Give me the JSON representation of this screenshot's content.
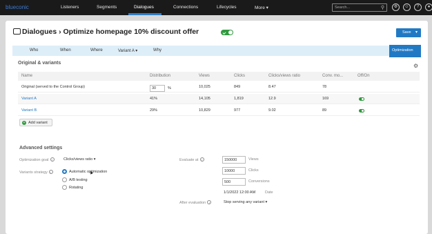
{
  "nav": {
    "logo": "blueconic",
    "items": [
      "Listeners",
      "Segments",
      "Dialogues",
      "Connections",
      "Lifecycles",
      "More ▾"
    ],
    "search_placeholder": "Search...",
    "icons": [
      "settings-icon",
      "user-icon",
      "help-icon",
      "account-icon"
    ]
  },
  "page": {
    "title": "Dialogues  ›  Optimize homepage 10% discount offer",
    "save_label": "Save",
    "tabs": [
      "Who",
      "When",
      "Where",
      "Variant A ▾",
      "Why"
    ],
    "active_tab": "Optimization"
  },
  "variants": {
    "heading": "Original & variants",
    "columns": [
      "Name",
      "Distribution",
      "Views",
      "Clicks",
      "Clicks/views ratio",
      "Conv. mo...",
      "Off/On"
    ],
    "rows": [
      {
        "name": "Original (served to the Control Group)",
        "distribution": "30",
        "pct": "%",
        "views": "10,025",
        "clicks": "849",
        "ratio": "8.47",
        "conv": "78",
        "toggle": false
      },
      {
        "name": "Variant A",
        "distribution": "41%",
        "views": "14,105",
        "clicks": "1,819",
        "ratio": "12.9",
        "conv": "169",
        "toggle": true
      },
      {
        "name": "Variant B",
        "distribution": "29%",
        "views": "10,829",
        "clicks": "977",
        "ratio": "9.02",
        "conv": "89",
        "toggle": true
      }
    ],
    "add_label": "Add variant"
  },
  "advanced": {
    "heading": "Advanced settings",
    "goal_label": "Optimization goal",
    "goal_value": "Clicks/views ratio ▾",
    "strategy_label": "Variants strategy",
    "strategies": [
      "Automatic optimization",
      "A/B testing",
      "Rotating"
    ],
    "evaluate_label": "Evaluate at",
    "evaluate": [
      {
        "value": "150000",
        "unit": "Views"
      },
      {
        "value": "10000",
        "unit": "Clicks"
      },
      {
        "value": "500",
        "unit": "Conversions"
      }
    ],
    "date_value": "1/1/2022 12:00 AM",
    "date_unit": "Date",
    "after_label": "After evaluation",
    "after_value": "Stop serving any variant ▾"
  },
  "colors": {
    "accent": "#2179c4",
    "toggle_on": "#2f9a3e",
    "topnav": "#1a1a1a"
  }
}
